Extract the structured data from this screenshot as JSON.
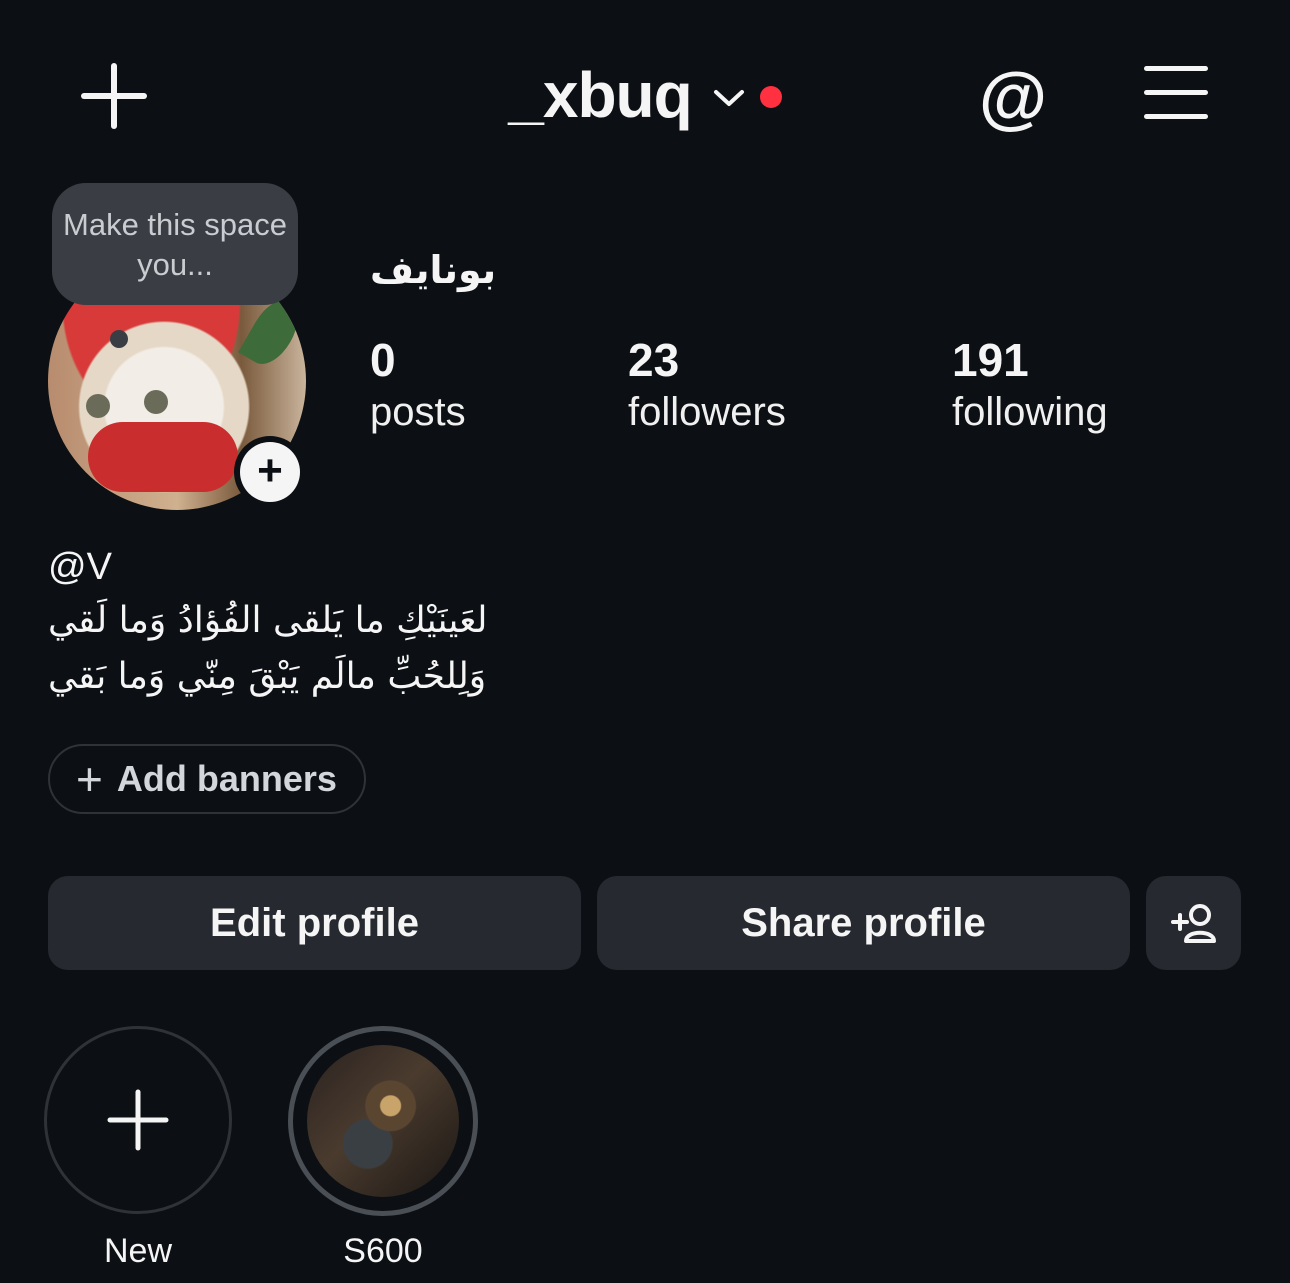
{
  "header": {
    "username": "_xbuq",
    "notification_dot_color": "#ff3040",
    "left_icon": "plus-icon",
    "right_icons": [
      "threads-icon",
      "menu-icon"
    ]
  },
  "tooltip": {
    "text": "Make this space you..."
  },
  "profile": {
    "display_name": "بونايف",
    "stats": [
      {
        "value": "0",
        "label": "posts"
      },
      {
        "value": "23",
        "label": "followers"
      },
      {
        "value": "191",
        "label": "following"
      }
    ]
  },
  "bio": {
    "mention": "@V",
    "lines": [
      "لعَينَيْكِ ما يَلقى الفُؤادُ وَما لَقي",
      "وَلِلحُبِّ مالَم يَبْقَ مِنّي وَما بَقي"
    ]
  },
  "banners": {
    "label": "Add banners"
  },
  "actions": {
    "edit_label": "Edit profile",
    "share_label": "Share profile",
    "discover_icon": "add-person-icon"
  },
  "highlights": [
    {
      "label": "New"
    },
    {
      "label": "S600"
    }
  ]
}
